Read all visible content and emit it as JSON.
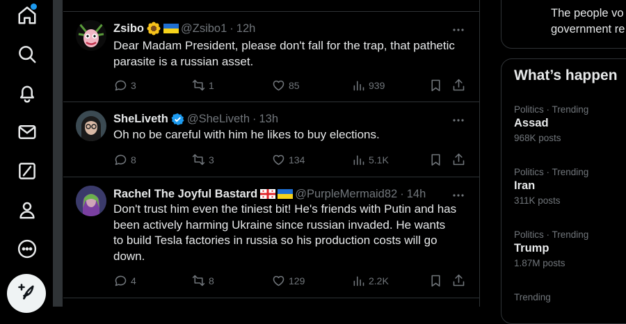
{
  "nav": {
    "items": [
      {
        "name": "home-icon",
        "icon": "home"
      },
      {
        "name": "explore-icon",
        "icon": "search"
      },
      {
        "name": "notifications-icon",
        "icon": "bell"
      },
      {
        "name": "messages-icon",
        "icon": "envelope"
      },
      {
        "name": "grok-icon",
        "icon": "slash-box"
      },
      {
        "name": "profile-icon",
        "icon": "person"
      },
      {
        "name": "more-icon",
        "icon": "dots-circle"
      }
    ],
    "compose_icon": "feather-plus",
    "accent": "#1d9bf0"
  },
  "tweets": [
    {
      "name": "Zsibo",
      "handle": "@Zsibo1",
      "time": "12h",
      "text": "Dear Madam President, please don't fall for the trap, that pathetic parasite is a russian asset.",
      "replies": "3",
      "reposts": "1",
      "likes": "85",
      "views": "939"
    },
    {
      "name": "SheLiveth",
      "handle": "@SheLiveth",
      "time": "13h",
      "verified": true,
      "text": "Oh no be careful with him he likes to buy elections.",
      "replies": "8",
      "reposts": "3",
      "likes": "134",
      "views": "5.1K"
    },
    {
      "name": "Rachel The Joyful Bastard",
      "handle": "@PurpleMermaid82",
      "time": "14h",
      "text": "Don't trust him even the tiniest bit! He's friends with Putin and has been actively harming Ukraine since russian invaded. He wants to build Tesla factories in russia so his production costs will go down.",
      "replies": "4",
      "reposts": "8",
      "likes": "129",
      "views": "2.2K"
    }
  ],
  "sidebar": {
    "prev_card_text_line1": "The people vo",
    "prev_card_text_line2": "government re",
    "trends_title": "What’s happen",
    "trends": [
      {
        "meta": "Politics · Trending",
        "name": "Assad",
        "posts": "968K posts"
      },
      {
        "meta": "Politics · Trending",
        "name": "Iran",
        "posts": "311K posts"
      },
      {
        "meta": "Politics · Trending",
        "name": "Trump",
        "posts": "1.87M posts"
      },
      {
        "meta": "Trending",
        "name": "",
        "posts": ""
      }
    ]
  }
}
